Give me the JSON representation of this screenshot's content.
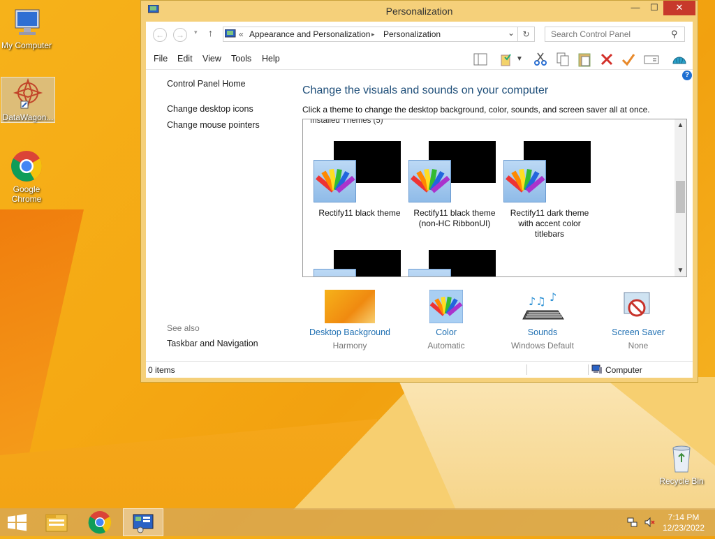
{
  "desktop": {
    "icons": [
      {
        "label": "My Computer",
        "icon": "computer-icon"
      },
      {
        "label": "DataWagon...",
        "icon": "datawagon-icon"
      },
      {
        "label": "Google Chrome",
        "icon": "chrome-icon"
      },
      {
        "label": "Recycle Bin",
        "icon": "recycle-bin-icon"
      }
    ]
  },
  "window": {
    "title": "Personalization",
    "controls": {
      "minimize": "—",
      "maximize": "☐",
      "close": "✕"
    },
    "address": {
      "prefix": "«",
      "crumbs": [
        "Appearance and Personalization",
        "Personalization"
      ],
      "separator": "▸",
      "dropdown": "⌄",
      "refresh": "↻",
      "search_placeholder": "Search Control Panel"
    },
    "menu": [
      "File",
      "Edit",
      "View",
      "Tools",
      "Help"
    ],
    "toolbar_icons": [
      "layout-icon",
      "properties-icon",
      "dropdown-arrow-icon",
      "cut-icon",
      "copy-icon",
      "paste-icon",
      "delete-icon",
      "check-icon",
      "rename-icon",
      "shell-icon"
    ],
    "left_nav": {
      "home": "Control Panel Home",
      "links": [
        "Change desktop icons",
        "Change mouse pointers"
      ],
      "see_also": "See also",
      "see_also_links": [
        "Taskbar and Navigation"
      ]
    },
    "heading": "Change the visuals and sounds on your computer",
    "description": "Click a theme to change the desktop background, color, sounds, and screen saver all at once.",
    "themes_group": "Installed Themes (5)",
    "themes": [
      {
        "name": "Rectify11 black theme"
      },
      {
        "name": "Rectify11 black theme (non-HC RibbonUI)"
      },
      {
        "name": "Rectify11 dark theme with accent color titlebars"
      },
      {
        "name": ""
      },
      {
        "name": ""
      }
    ],
    "bottom": [
      {
        "label": "Desktop Background",
        "value": "Harmony"
      },
      {
        "label": "Color",
        "value": "Automatic"
      },
      {
        "label": "Sounds",
        "value": "Windows Default"
      },
      {
        "label": "Screen Saver",
        "value": "None"
      }
    ],
    "status": {
      "items": "0 items",
      "location": "Computer"
    }
  },
  "taskbar": {
    "time": "7:14 PM",
    "date": "12/23/2022"
  },
  "colors": {
    "accent": "#f5d07a",
    "link": "#1e6fb2",
    "heading": "#1e4e79",
    "close": "#c7392b"
  }
}
